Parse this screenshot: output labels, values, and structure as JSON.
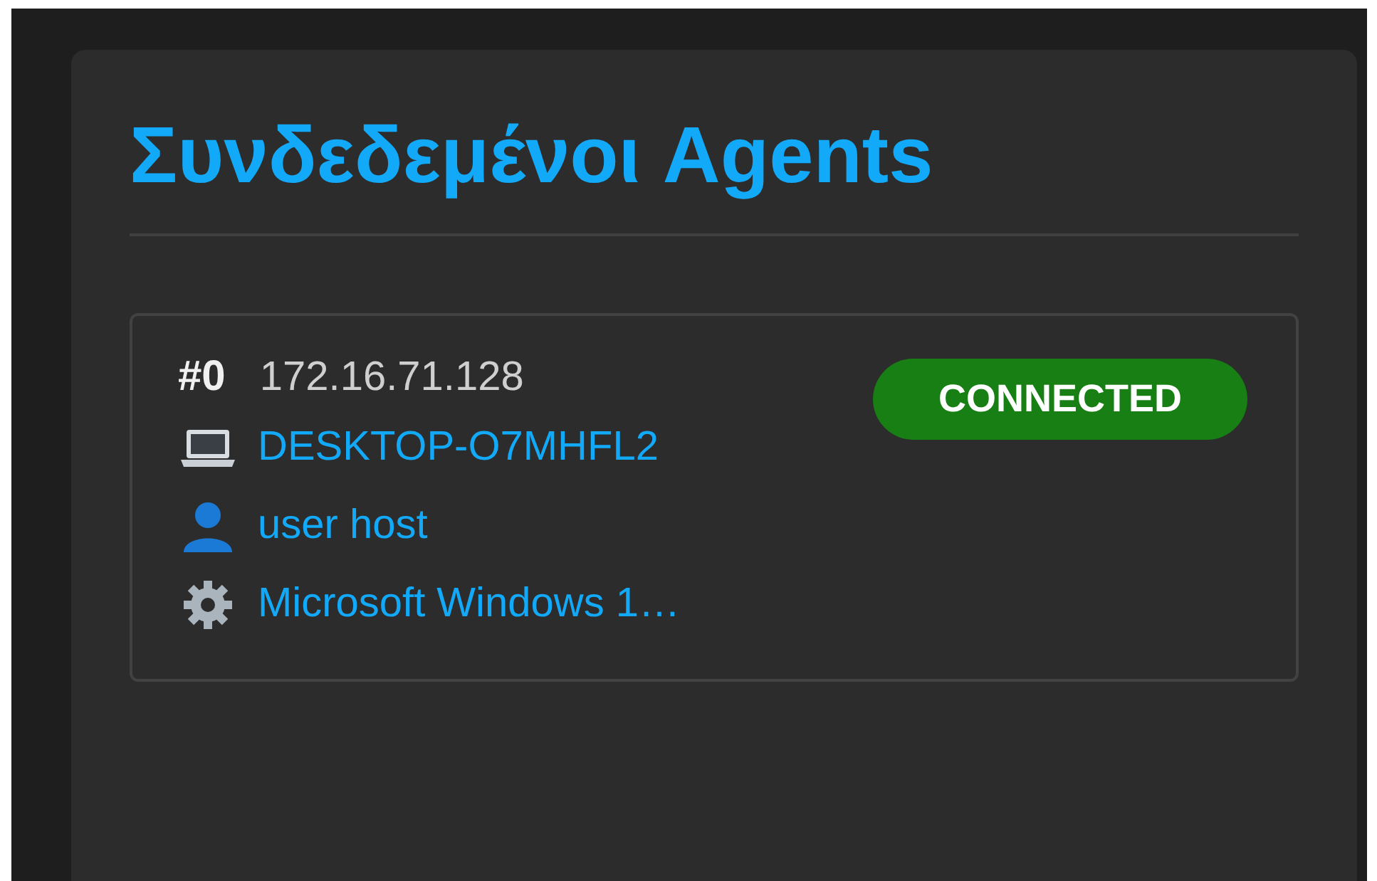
{
  "panel": {
    "title": "Συνδεδεμένοι Agents"
  },
  "agents": [
    {
      "index": "#0",
      "ip": "172.16.71.128",
      "status": {
        "kind": "connected",
        "label": "CONNECTED"
      },
      "details": [
        {
          "kind": "computer",
          "text": "DESKTOP-O7MHFL2"
        },
        {
          "kind": "user",
          "text": "user host"
        },
        {
          "kind": "os",
          "text": "Microsoft Windows 1…"
        }
      ]
    }
  ]
}
